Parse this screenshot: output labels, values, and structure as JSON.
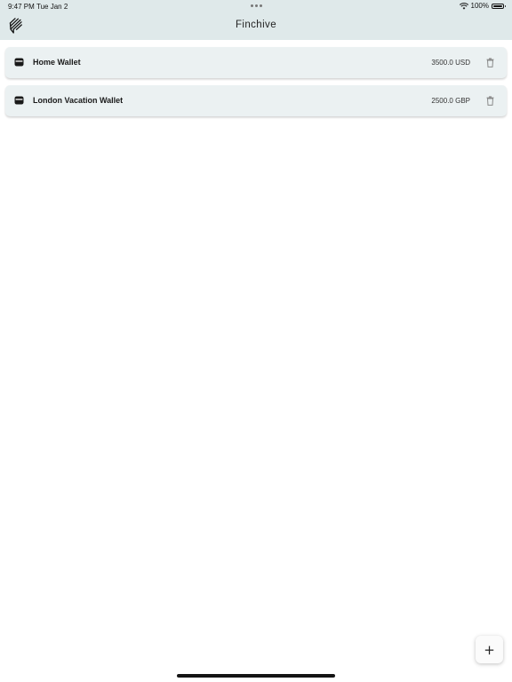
{
  "status_bar": {
    "time": "9:47 PM",
    "date": "Tue Jan 2",
    "battery": "100%"
  },
  "header": {
    "title": "Finchive",
    "menu_icon": "finchive-menu-icon"
  },
  "wallets": [
    {
      "name": "Home Wallet",
      "amount": "3500.0 USD",
      "icon": "wallet-icon"
    },
    {
      "name": "London Vacation Wallet",
      "amount": "2500.0 GBP",
      "icon": "wallet-icon"
    }
  ],
  "fab": {
    "label": "+",
    "icon": "plus-icon"
  },
  "colors": {
    "header_bg": "#dfe9ea",
    "card_bg": "#ebf1f2",
    "background": "#ffffff"
  }
}
